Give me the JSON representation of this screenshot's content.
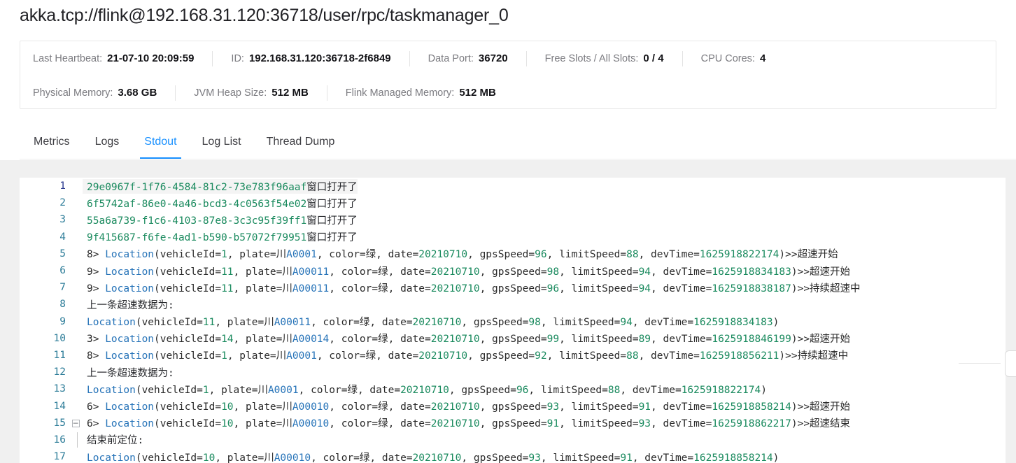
{
  "page_title": "akka.tcp://flink@192.168.31.120:36718/user/rpc/taskmanager_0",
  "info": {
    "row1": [
      {
        "label": "Last Heartbeat:",
        "value": "21-07-10 20:09:59"
      },
      {
        "label": "ID:",
        "value": "192.168.31.120:36718-2f6849"
      },
      {
        "label": "Data Port:",
        "value": "36720"
      },
      {
        "label": "Free Slots / All Slots:",
        "value": "0 / 4"
      },
      {
        "label": "CPU Cores:",
        "value": "4"
      }
    ],
    "row2": [
      {
        "label": "Physical Memory:",
        "value": "3.68 GB"
      },
      {
        "label": "JVM Heap Size:",
        "value": "512 MB"
      },
      {
        "label": "Flink Managed Memory:",
        "value": "512 MB"
      }
    ]
  },
  "tabs": [
    {
      "label": "Metrics",
      "active": false
    },
    {
      "label": "Logs",
      "active": false
    },
    {
      "label": "Stdout",
      "active": true
    },
    {
      "label": "Log List",
      "active": false
    },
    {
      "label": "Thread Dump",
      "active": false
    }
  ],
  "accent_color": "#1890ff",
  "editor": {
    "lines": [
      {
        "n": "1",
        "fold": "",
        "indent": false,
        "current": true,
        "tokens": [
          {
            "t": "29e0967f-1f76-4584-81c2-73e783f96aaf",
            "c": "t-green"
          },
          {
            "t": "窗口打开了",
            "c": "t-dark"
          }
        ]
      },
      {
        "n": "2",
        "fold": "",
        "indent": false,
        "current": false,
        "tokens": [
          {
            "t": "6f5742af-86e0-4a46-bcd3-4c0563f54e02",
            "c": "t-green"
          },
          {
            "t": "窗口打开了",
            "c": "t-dark"
          }
        ]
      },
      {
        "n": "3",
        "fold": "",
        "indent": false,
        "current": false,
        "tokens": [
          {
            "t": "55a6a739-f1c6-4103-87e8-3c3c95f39ff1",
            "c": "t-green"
          },
          {
            "t": "窗口打开了",
            "c": "t-dark"
          }
        ]
      },
      {
        "n": "4",
        "fold": "",
        "indent": false,
        "current": false,
        "tokens": [
          {
            "t": "9f415687-f6fe-4ad1-b590-b57072f79951",
            "c": "t-green"
          },
          {
            "t": "窗口打开了",
            "c": "t-dark"
          }
        ]
      },
      {
        "n": "5",
        "fold": "",
        "indent": false,
        "current": false,
        "tokens": [
          {
            "t": "8> ",
            "c": "t-plain"
          },
          {
            "t": "Location",
            "c": "t-kw"
          },
          {
            "t": "(vehicleId=",
            "c": "t-plain"
          },
          {
            "t": "1",
            "c": "t-num"
          },
          {
            "t": ", plate=",
            "c": "t-plain"
          },
          {
            "t": "川",
            "c": "t-plain"
          },
          {
            "t": "A0001",
            "c": "t-plate"
          },
          {
            "t": ", color=绿, date=",
            "c": "t-plain"
          },
          {
            "t": "20210710",
            "c": "t-num"
          },
          {
            "t": ", gpsSpeed=",
            "c": "t-plain"
          },
          {
            "t": "96",
            "c": "t-num"
          },
          {
            "t": ", limitSpeed=",
            "c": "t-plain"
          },
          {
            "t": "88",
            "c": "t-num"
          },
          {
            "t": ", devTime=",
            "c": "t-plain"
          },
          {
            "t": "1625918822174",
            "c": "t-num"
          },
          {
            "t": ")>>超速开始",
            "c": "t-plain"
          }
        ]
      },
      {
        "n": "6",
        "fold": "",
        "indent": false,
        "current": false,
        "tokens": [
          {
            "t": "9> ",
            "c": "t-plain"
          },
          {
            "t": "Location",
            "c": "t-kw"
          },
          {
            "t": "(vehicleId=",
            "c": "t-plain"
          },
          {
            "t": "11",
            "c": "t-num"
          },
          {
            "t": ", plate=",
            "c": "t-plain"
          },
          {
            "t": "川",
            "c": "t-plain"
          },
          {
            "t": "A00011",
            "c": "t-plate"
          },
          {
            "t": ", color=绿, date=",
            "c": "t-plain"
          },
          {
            "t": "20210710",
            "c": "t-num"
          },
          {
            "t": ", gpsSpeed=",
            "c": "t-plain"
          },
          {
            "t": "98",
            "c": "t-num"
          },
          {
            "t": ", limitSpeed=",
            "c": "t-plain"
          },
          {
            "t": "94",
            "c": "t-num"
          },
          {
            "t": ", devTime=",
            "c": "t-plain"
          },
          {
            "t": "1625918834183",
            "c": "t-num"
          },
          {
            "t": ")>>超速开始",
            "c": "t-plain"
          }
        ]
      },
      {
        "n": "7",
        "fold": "",
        "indent": false,
        "current": false,
        "tokens": [
          {
            "t": "9> ",
            "c": "t-plain"
          },
          {
            "t": "Location",
            "c": "t-kw"
          },
          {
            "t": "(vehicleId=",
            "c": "t-plain"
          },
          {
            "t": "11",
            "c": "t-num"
          },
          {
            "t": ", plate=",
            "c": "t-plain"
          },
          {
            "t": "川",
            "c": "t-plain"
          },
          {
            "t": "A00011",
            "c": "t-plate"
          },
          {
            "t": ", color=绿, date=",
            "c": "t-plain"
          },
          {
            "t": "20210710",
            "c": "t-num"
          },
          {
            "t": ", gpsSpeed=",
            "c": "t-plain"
          },
          {
            "t": "96",
            "c": "t-num"
          },
          {
            "t": ", limitSpeed=",
            "c": "t-plain"
          },
          {
            "t": "94",
            "c": "t-num"
          },
          {
            "t": ", devTime=",
            "c": "t-plain"
          },
          {
            "t": "1625918838187",
            "c": "t-num"
          },
          {
            "t": ")>>持续超速中",
            "c": "t-plain"
          }
        ]
      },
      {
        "n": "8",
        "fold": "",
        "indent": false,
        "current": false,
        "tokens": [
          {
            "t": "上一条超速数据为:",
            "c": "t-dark"
          }
        ]
      },
      {
        "n": "9",
        "fold": "",
        "indent": false,
        "current": false,
        "tokens": [
          {
            "t": "Location",
            "c": "t-kw"
          },
          {
            "t": "(vehicleId=",
            "c": "t-plain"
          },
          {
            "t": "11",
            "c": "t-num"
          },
          {
            "t": ", plate=",
            "c": "t-plain"
          },
          {
            "t": "川",
            "c": "t-plain"
          },
          {
            "t": "A00011",
            "c": "t-plate"
          },
          {
            "t": ", color=绿, date=",
            "c": "t-plain"
          },
          {
            "t": "20210710",
            "c": "t-num"
          },
          {
            "t": ", gpsSpeed=",
            "c": "t-plain"
          },
          {
            "t": "98",
            "c": "t-num"
          },
          {
            "t": ", limitSpeed=",
            "c": "t-plain"
          },
          {
            "t": "94",
            "c": "t-num"
          },
          {
            "t": ", devTime=",
            "c": "t-plain"
          },
          {
            "t": "1625918834183",
            "c": "t-num"
          },
          {
            "t": ")",
            "c": "t-plain"
          }
        ]
      },
      {
        "n": "10",
        "fold": "",
        "indent": false,
        "current": false,
        "tokens": [
          {
            "t": "3> ",
            "c": "t-plain"
          },
          {
            "t": "Location",
            "c": "t-kw"
          },
          {
            "t": "(vehicleId=",
            "c": "t-plain"
          },
          {
            "t": "14",
            "c": "t-num"
          },
          {
            "t": ", plate=",
            "c": "t-plain"
          },
          {
            "t": "川",
            "c": "t-plain"
          },
          {
            "t": "A00014",
            "c": "t-plate"
          },
          {
            "t": ", color=绿, date=",
            "c": "t-plain"
          },
          {
            "t": "20210710",
            "c": "t-num"
          },
          {
            "t": ", gpsSpeed=",
            "c": "t-plain"
          },
          {
            "t": "99",
            "c": "t-num"
          },
          {
            "t": ", limitSpeed=",
            "c": "t-plain"
          },
          {
            "t": "89",
            "c": "t-num"
          },
          {
            "t": ", devTime=",
            "c": "t-plain"
          },
          {
            "t": "1625918846199",
            "c": "t-num"
          },
          {
            "t": ")>>超速开始",
            "c": "t-plain"
          }
        ]
      },
      {
        "n": "11",
        "fold": "",
        "indent": false,
        "current": false,
        "tokens": [
          {
            "t": "8> ",
            "c": "t-plain"
          },
          {
            "t": "Location",
            "c": "t-kw"
          },
          {
            "t": "(vehicleId=",
            "c": "t-plain"
          },
          {
            "t": "1",
            "c": "t-num"
          },
          {
            "t": ", plate=",
            "c": "t-plain"
          },
          {
            "t": "川",
            "c": "t-plain"
          },
          {
            "t": "A0001",
            "c": "t-plate"
          },
          {
            "t": ", color=绿, date=",
            "c": "t-plain"
          },
          {
            "t": "20210710",
            "c": "t-num"
          },
          {
            "t": ", gpsSpeed=",
            "c": "t-plain"
          },
          {
            "t": "92",
            "c": "t-num"
          },
          {
            "t": ", limitSpeed=",
            "c": "t-plain"
          },
          {
            "t": "88",
            "c": "t-num"
          },
          {
            "t": ", devTime=",
            "c": "t-plain"
          },
          {
            "t": "1625918856211",
            "c": "t-num"
          },
          {
            "t": ")>>持续超速中",
            "c": "t-plain"
          }
        ]
      },
      {
        "n": "12",
        "fold": "",
        "indent": false,
        "current": false,
        "tokens": [
          {
            "t": "上一条超速数据为:",
            "c": "t-dark"
          }
        ]
      },
      {
        "n": "13",
        "fold": "",
        "indent": false,
        "current": false,
        "tokens": [
          {
            "t": "Location",
            "c": "t-kw"
          },
          {
            "t": "(vehicleId=",
            "c": "t-plain"
          },
          {
            "t": "1",
            "c": "t-num"
          },
          {
            "t": ", plate=",
            "c": "t-plain"
          },
          {
            "t": "川",
            "c": "t-plain"
          },
          {
            "t": "A0001",
            "c": "t-plate"
          },
          {
            "t": ", color=绿, date=",
            "c": "t-plain"
          },
          {
            "t": "20210710",
            "c": "t-num"
          },
          {
            "t": ", gpsSpeed=",
            "c": "t-plain"
          },
          {
            "t": "96",
            "c": "t-num"
          },
          {
            "t": ", limitSpeed=",
            "c": "t-plain"
          },
          {
            "t": "88",
            "c": "t-num"
          },
          {
            "t": ", devTime=",
            "c": "t-plain"
          },
          {
            "t": "1625918822174",
            "c": "t-num"
          },
          {
            "t": ")",
            "c": "t-plain"
          }
        ]
      },
      {
        "n": "14",
        "fold": "",
        "indent": false,
        "current": false,
        "tokens": [
          {
            "t": "6> ",
            "c": "t-plain"
          },
          {
            "t": "Location",
            "c": "t-kw"
          },
          {
            "t": "(vehicleId=",
            "c": "t-plain"
          },
          {
            "t": "10",
            "c": "t-num"
          },
          {
            "t": ", plate=",
            "c": "t-plain"
          },
          {
            "t": "川",
            "c": "t-plain"
          },
          {
            "t": "A00010",
            "c": "t-plate"
          },
          {
            "t": ", color=绿, date=",
            "c": "t-plain"
          },
          {
            "t": "20210710",
            "c": "t-num"
          },
          {
            "t": ", gpsSpeed=",
            "c": "t-plain"
          },
          {
            "t": "93",
            "c": "t-num"
          },
          {
            "t": ", limitSpeed=",
            "c": "t-plain"
          },
          {
            "t": "91",
            "c": "t-num"
          },
          {
            "t": ", devTime=",
            "c": "t-plain"
          },
          {
            "t": "1625918858214",
            "c": "t-num"
          },
          {
            "t": ")>>超速开始",
            "c": "t-plain"
          }
        ]
      },
      {
        "n": "15",
        "fold": "minus",
        "indent": false,
        "current": false,
        "tokens": [
          {
            "t": "6> ",
            "c": "t-plain"
          },
          {
            "t": "Location",
            "c": "t-kw"
          },
          {
            "t": "(vehicleId=",
            "c": "t-plain"
          },
          {
            "t": "10",
            "c": "t-num"
          },
          {
            "t": ", plate=",
            "c": "t-plain"
          },
          {
            "t": "川",
            "c": "t-plain"
          },
          {
            "t": "A00010",
            "c": "t-plate"
          },
          {
            "t": ", color=绿, date=",
            "c": "t-plain"
          },
          {
            "t": "20210710",
            "c": "t-num"
          },
          {
            "t": ", gpsSpeed=",
            "c": "t-plain"
          },
          {
            "t": "91",
            "c": "t-num"
          },
          {
            "t": ", limitSpeed=",
            "c": "t-plain"
          },
          {
            "t": "93",
            "c": "t-num"
          },
          {
            "t": ", devTime=",
            "c": "t-plain"
          },
          {
            "t": "1625918862217",
            "c": "t-num"
          },
          {
            "t": ")>>超速结束",
            "c": "t-plain"
          }
        ]
      },
      {
        "n": "16",
        "fold": "",
        "indent": true,
        "current": false,
        "tokens": [
          {
            "t": "结束前定位:",
            "c": "t-dark"
          }
        ]
      },
      {
        "n": "17",
        "fold": "",
        "indent": false,
        "current": false,
        "tokens": [
          {
            "t": "Location",
            "c": "t-kw"
          },
          {
            "t": "(vehicleId=",
            "c": "t-plain"
          },
          {
            "t": "10",
            "c": "t-num"
          },
          {
            "t": ", plate=",
            "c": "t-plain"
          },
          {
            "t": "川",
            "c": "t-plain"
          },
          {
            "t": "A00010",
            "c": "t-plate"
          },
          {
            "t": ", color=绿, date=",
            "c": "t-plain"
          },
          {
            "t": "20210710",
            "c": "t-num"
          },
          {
            "t": ", gpsSpeed=",
            "c": "t-plain"
          },
          {
            "t": "93",
            "c": "t-num"
          },
          {
            "t": ", limitSpeed=",
            "c": "t-plain"
          },
          {
            "t": "91",
            "c": "t-num"
          },
          {
            "t": ", devTime=",
            "c": "t-plain"
          },
          {
            "t": "1625918858214",
            "c": "t-num"
          },
          {
            "t": ")",
            "c": "t-plain"
          }
        ]
      }
    ]
  }
}
